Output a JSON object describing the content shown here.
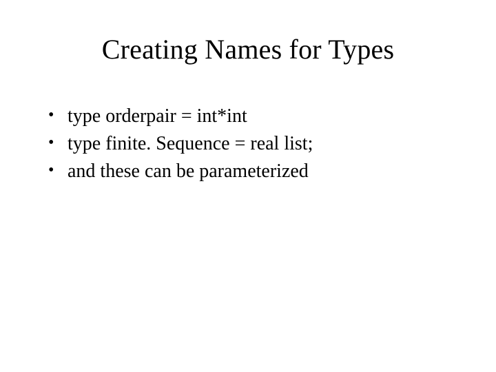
{
  "slide": {
    "title": "Creating Names for Types",
    "bullets": [
      "type orderpair = int*int",
      "type finite. Sequence = real list;",
      "and these can be parameterized"
    ]
  }
}
